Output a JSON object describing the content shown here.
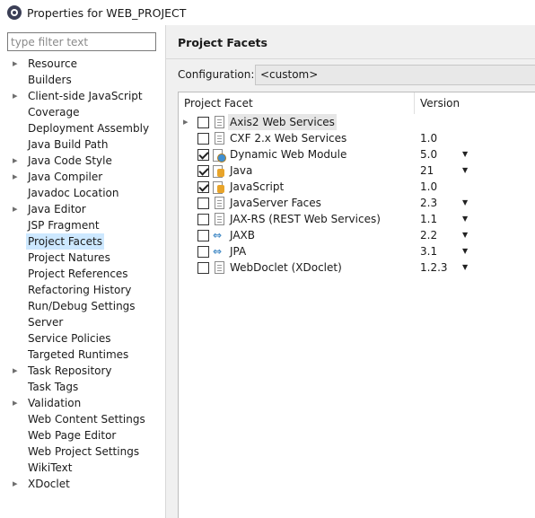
{
  "window": {
    "title": "Properties for WEB_PROJECT"
  },
  "filter": {
    "placeholder": "type filter text"
  },
  "nav": {
    "items": [
      {
        "label": "Resource",
        "expandable": true
      },
      {
        "label": "Builders",
        "expandable": false
      },
      {
        "label": "Client-side JavaScript",
        "expandable": true
      },
      {
        "label": "Coverage",
        "expandable": false
      },
      {
        "label": "Deployment Assembly",
        "expandable": false
      },
      {
        "label": "Java Build Path",
        "expandable": false
      },
      {
        "label": "Java Code Style",
        "expandable": true
      },
      {
        "label": "Java Compiler",
        "expandable": true
      },
      {
        "label": "Javadoc Location",
        "expandable": false
      },
      {
        "label": "Java Editor",
        "expandable": true
      },
      {
        "label": "JSP Fragment",
        "expandable": false
      },
      {
        "label": "Project Facets",
        "expandable": false,
        "selected": true
      },
      {
        "label": "Project Natures",
        "expandable": false
      },
      {
        "label": "Project References",
        "expandable": false
      },
      {
        "label": "Refactoring History",
        "expandable": false
      },
      {
        "label": "Run/Debug Settings",
        "expandable": false
      },
      {
        "label": "Server",
        "expandable": false
      },
      {
        "label": "Service Policies",
        "expandable": false
      },
      {
        "label": "Targeted Runtimes",
        "expandable": false
      },
      {
        "label": "Task Repository",
        "expandable": true
      },
      {
        "label": "Task Tags",
        "expandable": false
      },
      {
        "label": "Validation",
        "expandable": true
      },
      {
        "label": "Web Content Settings",
        "expandable": false
      },
      {
        "label": "Web Page Editor",
        "expandable": false
      },
      {
        "label": "Web Project Settings",
        "expandable": false
      },
      {
        "label": "WikiText",
        "expandable": false
      },
      {
        "label": "XDoclet",
        "expandable": true
      }
    ]
  },
  "page": {
    "title": "Project Facets",
    "configuration_label": "Configuration:",
    "configuration_value": "<custom>",
    "columns": {
      "facet": "Project Facet",
      "version": "Version"
    },
    "facets": [
      {
        "name": "Axis2 Web Services",
        "version": "",
        "checked": false,
        "expandable": true,
        "icon": "document-icon",
        "dropdown": false,
        "highlight": true
      },
      {
        "name": "CXF 2.x Web Services",
        "version": "1.0",
        "checked": false,
        "expandable": false,
        "icon": "document-icon",
        "dropdown": false
      },
      {
        "name": "Dynamic Web Module",
        "version": "5.0",
        "checked": true,
        "expandable": false,
        "icon": "web-module-icon",
        "dropdown": true
      },
      {
        "name": "Java",
        "version": "21",
        "checked": true,
        "expandable": false,
        "icon": "java-icon",
        "dropdown": true
      },
      {
        "name": "JavaScript",
        "version": "1.0",
        "checked": true,
        "expandable": false,
        "icon": "java-icon",
        "dropdown": false
      },
      {
        "name": "JavaServer Faces",
        "version": "2.3",
        "checked": false,
        "expandable": false,
        "icon": "document-icon",
        "dropdown": true
      },
      {
        "name": "JAX-RS (REST Web Services)",
        "version": "1.1",
        "checked": false,
        "expandable": false,
        "icon": "document-icon",
        "dropdown": true
      },
      {
        "name": "JAXB",
        "version": "2.2",
        "checked": false,
        "expandable": false,
        "icon": "arrows-icon",
        "dropdown": true
      },
      {
        "name": "JPA",
        "version": "3.1",
        "checked": false,
        "expandable": false,
        "icon": "arrows-icon",
        "dropdown": true
      },
      {
        "name": "WebDoclet (XDoclet)",
        "version": "1.2.3",
        "checked": false,
        "expandable": false,
        "icon": "document-icon",
        "dropdown": true
      }
    ]
  },
  "icons": {
    "expander": "▸",
    "dropdown": "▼",
    "arrows": "⇔"
  },
  "colors": {
    "selection": "#cde8ff",
    "panel_bg": "#f0f0f0"
  }
}
